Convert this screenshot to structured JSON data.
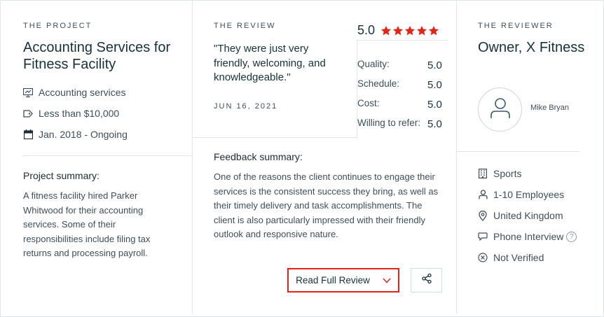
{
  "project": {
    "eyebrow": "THE PROJECT",
    "title": "Accounting Services for Fitness Facility",
    "service": "Accounting services",
    "budget": "Less than $10,000",
    "dates": "Jan. 2018 - Ongoing",
    "summary_label": "Project summary:",
    "summary_text": "A fitness facility hired Parker Whitwood for their accounting services. Some of their responsibilities include filing tax returns and processing payroll."
  },
  "review": {
    "eyebrow": "THE REVIEW",
    "quote": "\"They were just very friendly, welcoming, and knowledgeable.\"",
    "date": "JUN 16, 2021",
    "overall": "5.0",
    "stars": 5,
    "star_color": "#e62415",
    "ratings": [
      {
        "label": "Quality:",
        "value": "5.0"
      },
      {
        "label": "Schedule:",
        "value": "5.0"
      },
      {
        "label": "Cost:",
        "value": "5.0"
      },
      {
        "label": "Willing to refer:",
        "value": "5.0"
      }
    ],
    "feedback_label": "Feedback summary:",
    "feedback_text": "One of the reasons the client continues to engage their services is the consistent success they bring, as well as their timely delivery and task accomplishments. The client is also particularly impressed with their friendly outlook and responsive nature.",
    "read_button": "Read Full Review",
    "accent_color": "#e62415"
  },
  "reviewer": {
    "eyebrow": "THE REVIEWER",
    "title": "Owner, X Fitness",
    "name": "Mike Bryan",
    "industry": "Sports",
    "employees": "1-10 Employees",
    "location": "United Kingdom",
    "interview": "Phone Interview",
    "interview_help": "?",
    "verification": "Not Verified"
  }
}
